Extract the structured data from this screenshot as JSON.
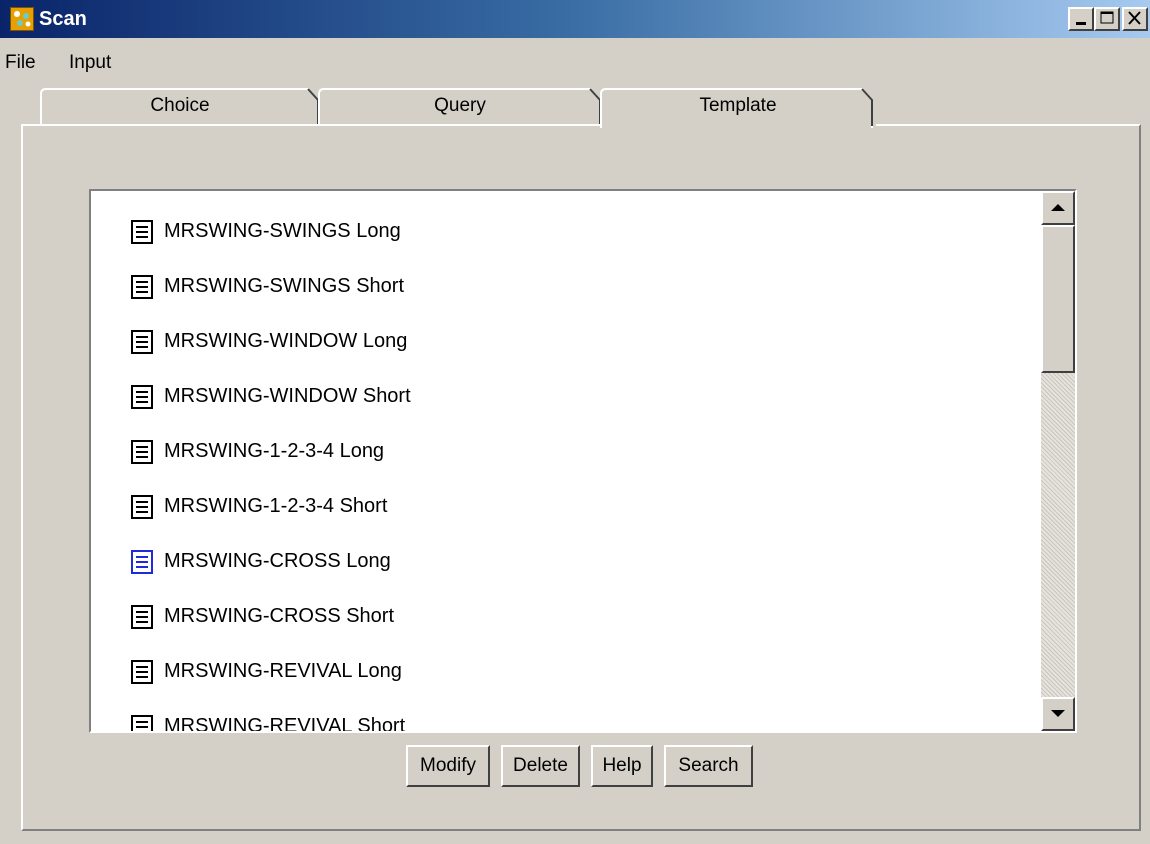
{
  "window": {
    "title": "Scan",
    "controls": [
      "minimize-icon",
      "maximize-icon",
      "close-icon"
    ]
  },
  "menu": [
    "File",
    "Input"
  ],
  "tabs": [
    {
      "label": "Choice",
      "selected": false
    },
    {
      "label": "Query",
      "selected": false
    },
    {
      "label": "Template",
      "selected": true
    }
  ],
  "templates": [
    {
      "label": "MRSWING-SWINGS Long",
      "icon": "document-icon"
    },
    {
      "label": "MRSWING-SWINGS Short",
      "icon": "document-icon"
    },
    {
      "label": "MRSWING-WINDOW Long",
      "icon": "document-icon"
    },
    {
      "label": "MRSWING-WINDOW Short",
      "icon": "document-icon"
    },
    {
      "label": "MRSWING-1-2-3-4 Long",
      "icon": "document-icon"
    },
    {
      "label": "MRSWING-1-2-3-4 Short",
      "icon": "document-icon"
    },
    {
      "label": "MRSWING-CROSS Long",
      "icon": "document-icon",
      "highlighted": true
    },
    {
      "label": "MRSWING-CROSS Short",
      "icon": "document-icon"
    },
    {
      "label": "MRSWING-REVIVAL Long",
      "icon": "document-icon"
    },
    {
      "label": "MRSWING-REVIVAL Short",
      "icon": "document-icon"
    }
  ],
  "buttons": {
    "modify": "Modify",
    "delete": "Delete",
    "help": "Help",
    "search": "Search"
  },
  "colors": {
    "titlebar_start": "#0a246a",
    "titlebar_end": "#a6caf0",
    "face": "#d4d0c8",
    "highlight_icon": "#1f2bd6"
  }
}
